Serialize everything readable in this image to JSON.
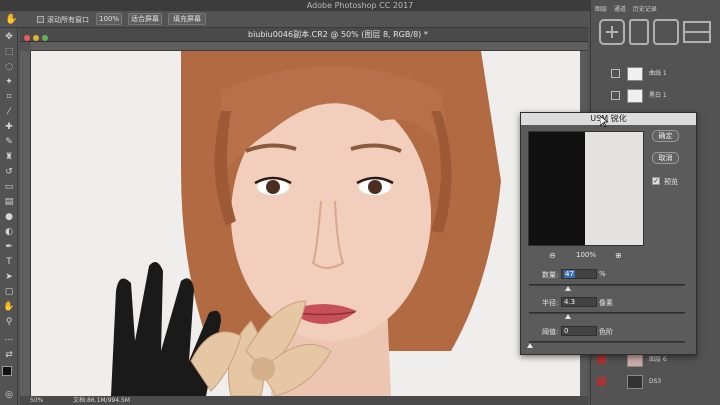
{
  "app": {
    "title": "Adobe Photoshop CC 2017"
  },
  "options_bar": {
    "scroll_all_label": "滚动所有窗口",
    "zoom_value": "100%",
    "fit_screen": "适合屏幕",
    "fill_screen": "填充屏幕"
  },
  "document": {
    "title": "biubiu0046副本.CR2 @ 50% (图层 8, RGB/8) *",
    "status_zoom": "50%",
    "status_info": "文档:86.1M/994.5M"
  },
  "panel": {
    "tabs": [
      "图层",
      "通道",
      "历史记录"
    ],
    "layers": [
      {
        "name": "曲线 1"
      },
      {
        "name": "黑白 1"
      },
      {
        "name": "图层 6"
      },
      {
        "name": "DS3"
      }
    ]
  },
  "dialog": {
    "title": "USM 锐化",
    "ok": "确定",
    "cancel": "取消",
    "preview_label": "预览",
    "preview_zoom": "100%",
    "amount_label": "数量:",
    "amount_value": "47",
    "amount_unit": "%",
    "radius_label": "半径:",
    "radius_value": "4.3",
    "radius_unit": "像素",
    "threshold_label": "阈值:",
    "threshold_value": "0",
    "threshold_unit": "色阶"
  },
  "colors": {
    "chrome": "#535353",
    "titlebar": "#3c3c3c",
    "canvas_bg": "#f0efee",
    "selection": "#3d6fb0",
    "hair": "#b0663c",
    "lips": "#c8505a"
  },
  "icons": [
    "move-icon",
    "marquee-icon",
    "lasso-icon",
    "magic-wand-icon",
    "crop-icon",
    "eyedropper-icon",
    "healing-icon",
    "brush-icon",
    "stamp-icon",
    "history-brush-icon",
    "eraser-icon",
    "gradient-icon",
    "blur-icon",
    "dodge-icon",
    "pen-icon",
    "type-icon",
    "path-select-icon",
    "shape-icon",
    "hand-icon",
    "zoom-icon",
    "eye-icon",
    "zoom-in-icon",
    "zoom-out-icon"
  ]
}
